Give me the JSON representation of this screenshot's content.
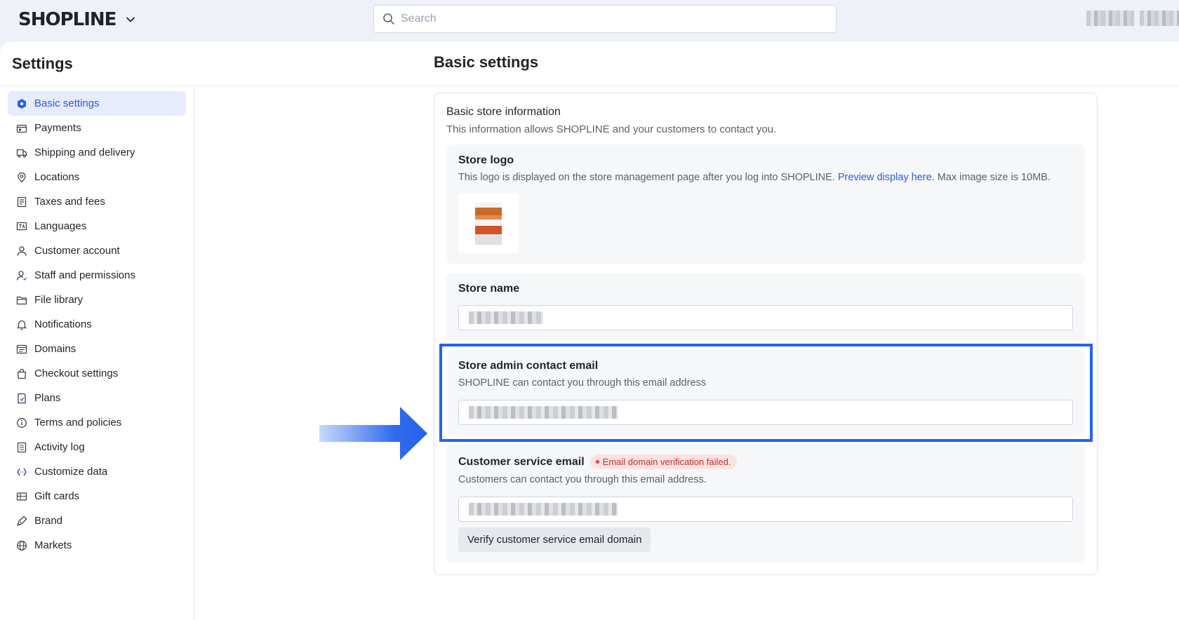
{
  "header": {
    "logo": "SHOPLINE",
    "search_placeholder": "Search"
  },
  "page": {
    "title": "Settings"
  },
  "sidebar": {
    "items": [
      {
        "label": "Basic settings",
        "icon": "hexagon-icon",
        "active": true
      },
      {
        "label": "Payments",
        "icon": "wallet-icon"
      },
      {
        "label": "Shipping and delivery",
        "icon": "truck-icon"
      },
      {
        "label": "Locations",
        "icon": "location-pin-icon"
      },
      {
        "label": "Taxes and fees",
        "icon": "receipt-icon"
      },
      {
        "label": "Languages",
        "icon": "language-icon"
      },
      {
        "label": "Customer account",
        "icon": "user-icon"
      },
      {
        "label": "Staff and permissions",
        "icon": "staff-icon"
      },
      {
        "label": "File library",
        "icon": "folder-icon"
      },
      {
        "label": "Notifications",
        "icon": "bell-icon"
      },
      {
        "label": "Domains",
        "icon": "domain-icon"
      },
      {
        "label": "Checkout settings",
        "icon": "bag-icon"
      },
      {
        "label": "Plans",
        "icon": "plan-icon"
      },
      {
        "label": "Terms and policies",
        "icon": "info-icon"
      },
      {
        "label": "Activity log",
        "icon": "log-icon"
      },
      {
        "label": "Customize data",
        "icon": "code-icon"
      },
      {
        "label": "Gift cards",
        "icon": "gift-card-icon"
      },
      {
        "label": "Brand",
        "icon": "brand-icon"
      },
      {
        "label": "Markets",
        "icon": "globe-icon"
      }
    ]
  },
  "main": {
    "title": "Basic settings",
    "card": {
      "title": "Basic store information",
      "desc": "This information allows SHOPLINE and your customers to contact you.",
      "store_logo": {
        "title": "Store logo",
        "desc_before": "This logo is displayed on the store management page after you log into SHOPLINE. ",
        "link": "Preview display here.",
        "desc_after": " Max image size is 10MB."
      },
      "store_name": {
        "title": "Store name"
      },
      "admin_email": {
        "title": "Store admin contact email",
        "desc": "SHOPLINE can contact you through this email address"
      },
      "service_email": {
        "title": "Customer service email",
        "badge": "Email domain verification failed.",
        "desc": "Customers can contact you through this email address.",
        "button": "Verify customer service email domain"
      }
    }
  },
  "colors": {
    "accent": "#2563eb",
    "active_bg": "#e6ecfc",
    "error": "#c0302b",
    "error_bg": "#fde2e1"
  }
}
